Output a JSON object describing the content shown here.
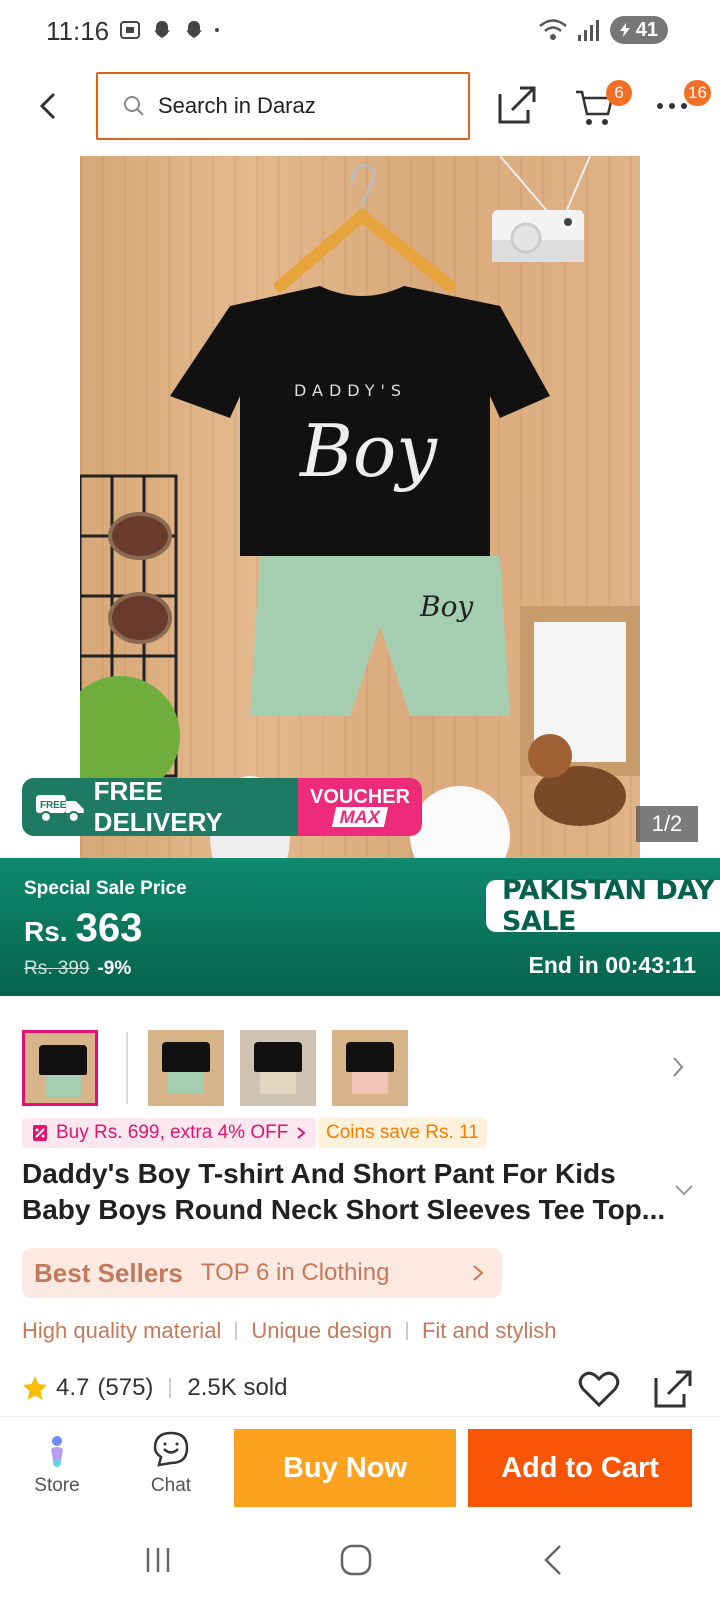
{
  "status_bar": {
    "time": "11:16",
    "battery": "41"
  },
  "search": {
    "placeholder": "Search in Daraz"
  },
  "header": {
    "cart_count": "6",
    "more_count": "16"
  },
  "image": {
    "counter": "1/2",
    "free_delivery": "FREE DELIVERY",
    "free_tag": "FREE",
    "voucher_line1": "VOUCHER",
    "voucher_line2": "MAX",
    "shirt_text_top": "DADDY'S",
    "shirt_text_main": "Boy"
  },
  "sale": {
    "label": "Special Sale Price",
    "currency": "Rs.",
    "price": "363",
    "old_price": "Rs. 399",
    "discount": "-9%",
    "campaign": "PAKISTAN DAY SALE",
    "countdown": "End in 00:43:11"
  },
  "promos": {
    "chip1": "Buy Rs. 699, extra 4% OFF",
    "chip2": "Coins save Rs. 11"
  },
  "product": {
    "title": "Daddy's Boy T-shirt And Short Pant For Kids Baby Boys Round Neck Short Sleeves Tee Top..."
  },
  "best_sellers": {
    "logo": "Best Sellers",
    "text": "TOP 6 in Clothing"
  },
  "features": [
    "High quality material",
    "Unique design",
    "Fit and stylish"
  ],
  "rating": {
    "score": "4.7",
    "count": "(575)",
    "sold": "2.5K sold"
  },
  "bottom_bar": {
    "store": "Store",
    "chat": "Chat",
    "buy_now": "Buy Now",
    "add_to_cart": "Add to Cart"
  },
  "colors": {
    "brand_orange": "#f85606",
    "buy_now": "#fca21e",
    "sale_green": "#0f8a6e",
    "pink": "#e2136e"
  }
}
